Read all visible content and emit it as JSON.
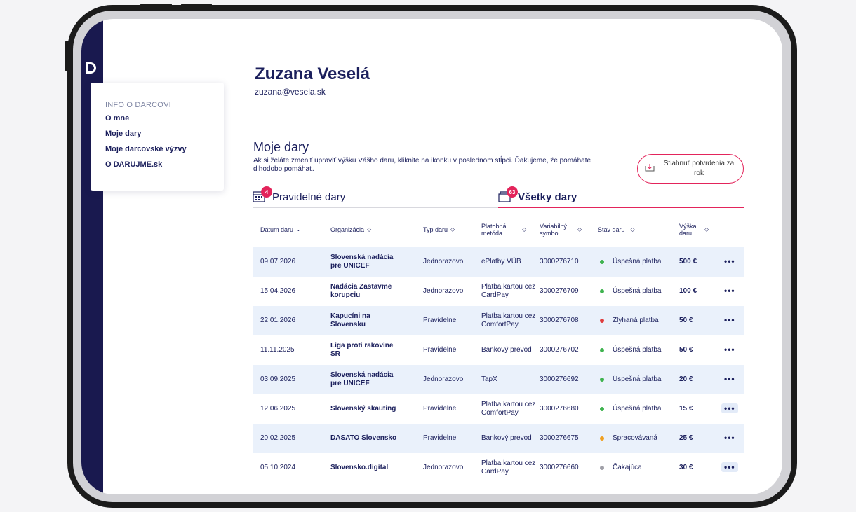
{
  "user": {
    "name": "Zuzana Veselá",
    "email": "zuzana@vesela.sk"
  },
  "sidebar": {
    "title": "INFO O DARCOVI",
    "items": [
      "O mne",
      "Moje dary",
      "Moje darcovské výzvy",
      "O DARUJME.sk"
    ]
  },
  "section": {
    "title": "Moje dary",
    "description": "Ak si želáte zmeniť upraviť výšku Vášho daru, kliknite na ikonku v poslednom stĺpci. Ďakujeme, že pomáhate dlhodobo pomáhať.",
    "download_label": "Stiahnuť potvrdenia za rok"
  },
  "tabs": [
    {
      "label": "Pravidelné dary",
      "badge": "4",
      "icon": "calendar-icon"
    },
    {
      "label": "Všetky dary",
      "badge": "63",
      "icon": "folder-icon"
    }
  ],
  "table": {
    "headers": [
      "Dátum daru",
      "Organizácia",
      "Typ daru",
      "Platobná metóda",
      "Variabilný symbol",
      "Stav daru",
      "Výška daru"
    ],
    "rows": [
      {
        "date": "09.07.2026",
        "org": "Slovenská nadácia pre UNICEF",
        "type": "Jednorazovo",
        "method": "ePlatby VÚB",
        "vs": "3000276710",
        "status": "Úspešná platba",
        "status_color": "#3fb34f",
        "amount": "500 €"
      },
      {
        "date": "15.04.2026",
        "org": "Nadácia Zastavme korupciu",
        "type": "Jednorazovo",
        "method": "Platba kartou cez CardPay",
        "vs": "3000276709",
        "status": "Úspešná platba",
        "status_color": "#3fb34f",
        "amount": "100 €"
      },
      {
        "date": "22.01.2026",
        "org": "Kapucíni na Slovensku",
        "type": "Pravidelne",
        "method": "Platba kartou cez ComfortPay",
        "vs": "3000276708",
        "status": "Zlyhaná platba",
        "status_color": "#e03c3c",
        "amount": "50 €"
      },
      {
        "date": "11.11.2025",
        "org": "Liga proti rakovine SR",
        "type": "Pravidelne",
        "method": "Bankový prevod",
        "vs": "3000276702",
        "status": "Úspešná platba",
        "status_color": "#3fb34f",
        "amount": "50 €"
      },
      {
        "date": "03.09.2025",
        "org": "Slovenská nadácia pre UNICEF",
        "type": "Jednorazovo",
        "method": "TapX",
        "vs": "3000276692",
        "status": "Úspešná platba",
        "status_color": "#3fb34f",
        "amount": "20 €"
      },
      {
        "date": "12.06.2025",
        "org": "Slovenský skauting",
        "type": "Pravidelne",
        "method": "Platba kartou cez ComfortPay",
        "vs": "3000276680",
        "status": "Úspešná platba",
        "status_color": "#3fb34f",
        "amount": "15 €"
      },
      {
        "date": "20.02.2025",
        "org": "DASATO Slovensko",
        "type": "Pravidelne",
        "method": "Bankový prevod",
        "vs": "3000276675",
        "status": "Spracovávaná",
        "status_color": "#f0a020",
        "amount": "25 €"
      },
      {
        "date": "05.10.2024",
        "org": "Slovensko.digital",
        "type": "Jednorazovo",
        "method": "Platba kartou cez CardPay",
        "vs": "3000276660",
        "status": "Čakajúca",
        "status_color": "#a0a0a8",
        "amount": "30 €"
      }
    ],
    "more_label": "•••"
  },
  "colors": {
    "accent": "#e3245b",
    "navy": "#19194f",
    "row_alt": "#eaf1fb"
  }
}
